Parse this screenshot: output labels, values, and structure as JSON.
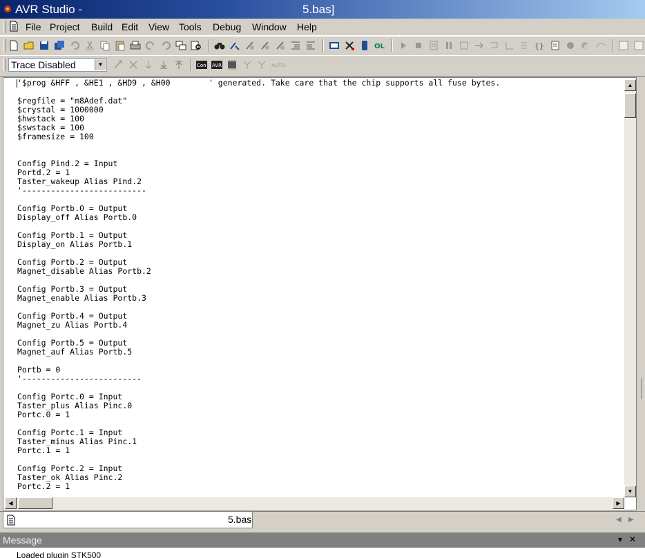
{
  "window": {
    "app_name": "AVR Studio -",
    "file_suffix": "5.bas]"
  },
  "menu": [
    {
      "label": "File"
    },
    {
      "label": "Project"
    },
    {
      "label": "Build"
    },
    {
      "label": "Edit"
    },
    {
      "label": "View"
    },
    {
      "label": "Tools"
    },
    {
      "label": "Debug"
    },
    {
      "label": "Window"
    },
    {
      "label": "Help"
    }
  ],
  "trace_select": {
    "value": "Trace Disabled"
  },
  "toolbar2_labels": {
    "con": "Con",
    "avr": "AVR",
    "auto": "AUTO"
  },
  "toolbar1_labels": {
    "ol": "OL"
  },
  "code_lines": [
    "'$prog &HFF , &HE1 , &HD9 , &H00        ' generated. Take care that the chip supports all fuse bytes.",
    "",
    "$regfile = \"m8Adef.dat\"",
    "$crystal = 1000000",
    "$hwstack = 100",
    "$swstack = 100",
    "$framesize = 100",
    "",
    "",
    "Config Pind.2 = Input",
    "Portd.2 = 1",
    "Taster_wakeup Alias Pind.2",
    "'--------------------------",
    "",
    "Config Portb.0 = Output",
    "Display_off Alias Portb.0",
    "",
    "Config Portb.1 = Output",
    "Display_on Alias Portb.1",
    "",
    "Config Portb.2 = Output",
    "Magnet_disable Alias Portb.2",
    "",
    "Config Portb.3 = Output",
    "Magnet_enable Alias Portb.3",
    "",
    "Config Portb.4 = Output",
    "Magnet_zu Alias Portb.4",
    "",
    "Config Portb.5 = Output",
    "Magnet_auf Alias Portb.5",
    "",
    "Portb = 0",
    "'-------------------------",
    "",
    "Config Portc.0 = Input",
    "Taster_plus Alias Pinc.0",
    "Portc.0 = 1",
    "",
    "Config Portc.1 = Input",
    "Taster_minus Alias Pinc.1",
    "Portc.1 = 1",
    "",
    "Config Portc.2 = Input",
    "Taster_ok Alias Pinc.2",
    "Portc.2 = 1"
  ],
  "doc_tab": {
    "name": "5.bas"
  },
  "message_panel": {
    "title": "Message",
    "line": "Loaded plugin STK500"
  }
}
